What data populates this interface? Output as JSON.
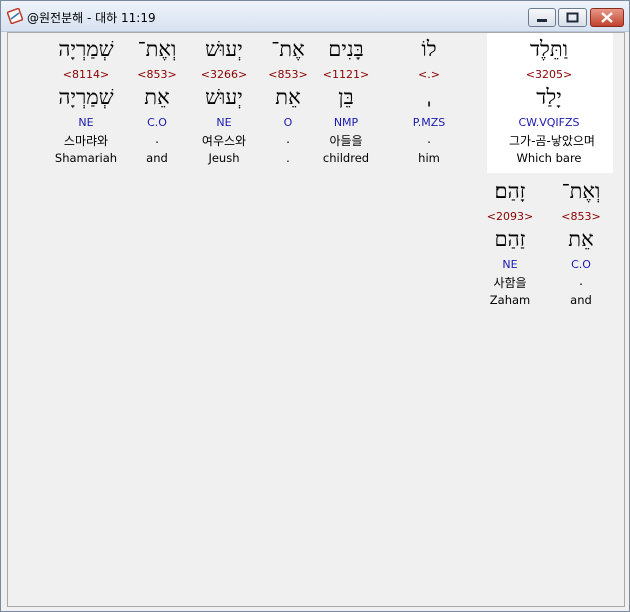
{
  "window": {
    "title": "@원전분해 - 대하 11:19"
  },
  "words_line1": [
    {
      "hebrew": "וַתֵּלֶד",
      "strong": "<3205>",
      "root": "יָלַד",
      "grammar": "CW.VQIFZS",
      "korean": "그가-곰-낳았으며",
      "english": "Which bare"
    },
    {
      "hebrew": "לוֹ",
      "strong": "<.>",
      "root": "ˌ",
      "grammar": "P.MZS",
      "korean": ".",
      "english": "him"
    },
    {
      "hebrew": "בָּנִים",
      "strong": "<1121>",
      "root": "בֵּן",
      "grammar": "NMP",
      "korean": "아들을",
      "english": "childred"
    },
    {
      "hebrew": "אֶת־",
      "strong": "<853>",
      "root": "אֵת",
      "grammar": "O",
      "korean": ".",
      "english": "."
    },
    {
      "hebrew": "יְעוּשׁ",
      "strong": "<3266>",
      "root": "יְעוּשׁ",
      "grammar": "NE",
      "korean": "여우스와",
      "english": "Jeush"
    },
    {
      "hebrew": "וְאֶת־",
      "strong": "<853>",
      "root": "אֵת",
      "grammar": "C.O",
      "korean": ".",
      "english": "and"
    },
    {
      "hebrew": "שְׁמַרְיָה",
      "strong": "<8114>",
      "root": "שְׁמַרְיָה",
      "grammar": "NE",
      "korean": "스마랴와",
      "english": "Shamariah"
    }
  ],
  "words_line2": [
    {
      "hebrew": "וְאֶת־",
      "strong": "<853>",
      "root": "אֵת",
      "grammar": "C.O",
      "korean": ".",
      "english": "and"
    },
    {
      "hebrew": "זָהַם׃",
      "strong": "<2093>",
      "root": "זַהַם",
      "grammar": "NE",
      "korean": "사함을",
      "english": "Zaham"
    }
  ]
}
